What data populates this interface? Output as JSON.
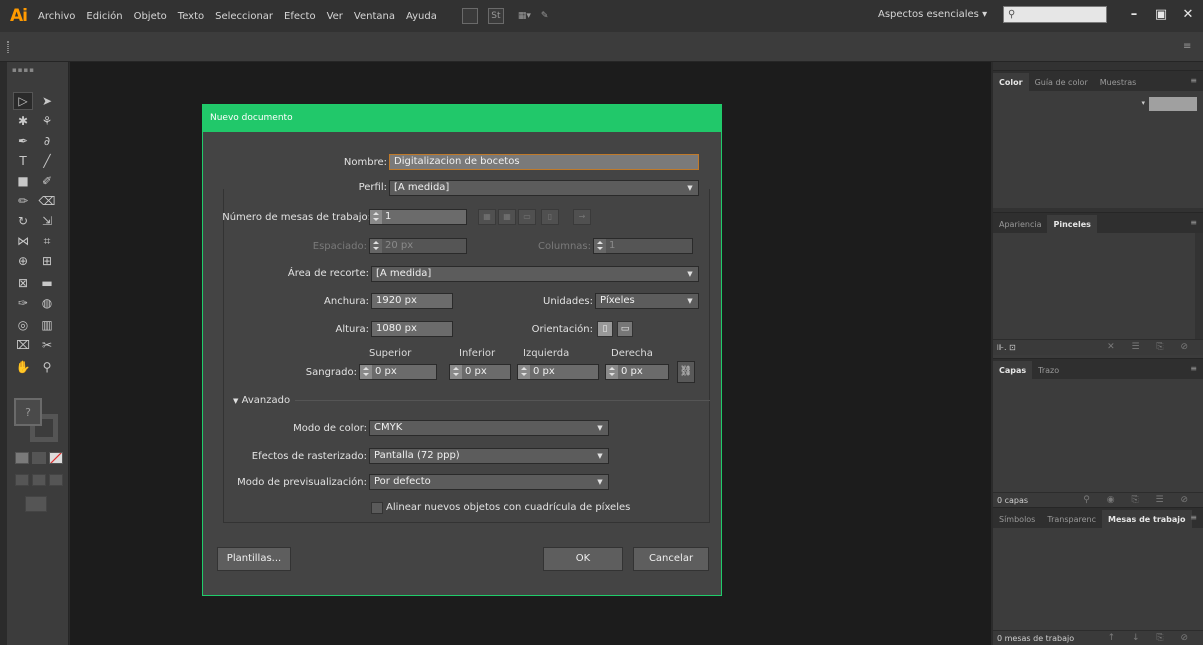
{
  "app": {
    "logo": "Ai",
    "menus": [
      "Archivo",
      "Edición",
      "Objeto",
      "Texto",
      "Seleccionar",
      "Efecto",
      "Ver",
      "Ventana",
      "Ayuda"
    ],
    "bridge_label": "Br",
    "stock_label": "St",
    "workspace": "Aspectos esenciales",
    "workspace_arrow": "▾",
    "window_controls": {
      "minimize": "–",
      "maximize": "🗗",
      "close": "✕"
    }
  },
  "right_panels": {
    "color_panel": {
      "tabs": [
        "Color",
        "Guía de color",
        "Muestras"
      ],
      "active": 0
    },
    "brushes_panel": {
      "tabs": [
        "Apariencia",
        "Pinceles"
      ],
      "active": 1
    },
    "layers_panel": {
      "tabs": [
        "Capas",
        "Trazo"
      ],
      "active": 0,
      "footer": "0 capas"
    },
    "artboards_panel": {
      "tabs": [
        "Símbolos",
        "Transparenc",
        "Mesas de trabajo"
      ],
      "active": 2,
      "footer": "0 mesas de trabajo"
    }
  },
  "dialog": {
    "title": "Nuevo documento",
    "name_label": "Nombre:",
    "name_value": "Digitalizacion de bocetos",
    "profile_label": "Perfil:",
    "profile_value": "[A medida]",
    "artboards_label": "Número de mesas de trabajo:",
    "artboards_value": "1",
    "spacing_label": "Espaciado:",
    "spacing_value": "20 px",
    "columns_label": "Columnas:",
    "columns_value": "1",
    "crop_label": "Área de recorte:",
    "crop_value": "[A medida]",
    "width_label": "Anchura:",
    "width_value": "1920 px",
    "units_label": "Unidades:",
    "units_value": "Píxeles",
    "height_label": "Altura:",
    "height_value": "1080 px",
    "orientation_label": "Orientación:",
    "bleed": {
      "label": "Sangrado:",
      "top_label": "Superior",
      "bottom_label": "Inferior",
      "left_label": "Izquierda",
      "right_label": "Derecha",
      "top": "0 px",
      "bottom": "0 px",
      "left": "0 px",
      "right": "0 px"
    },
    "advanced_label": "Avanzado",
    "color_mode_label": "Modo de color:",
    "color_mode_value": "CMYK",
    "raster_label": "Efectos de rasterizado:",
    "raster_value": "Pantalla (72 ppp)",
    "preview_label": "Modo de previsualización:",
    "preview_value": "Por defecto",
    "align_label": "Alinear nuevos objetos con cuadrícula de píxeles",
    "templates_button": "Plantillas...",
    "ok_button": "OK",
    "cancel_button": "Cancelar"
  },
  "colors": {
    "dialog_title_bg": "#21c86a",
    "logo": "#ff9a00",
    "canvas": "#1c1c1c"
  }
}
